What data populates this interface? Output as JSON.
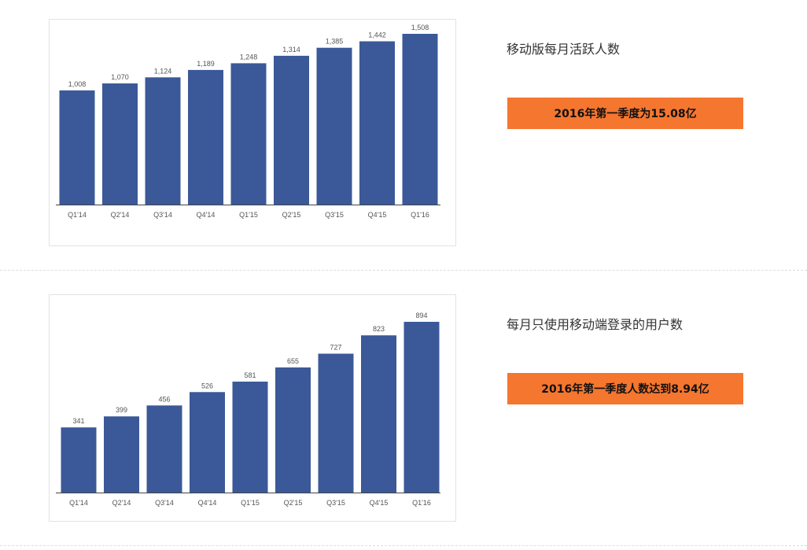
{
  "sections": [
    {
      "side_title": "移动版每月活跃人数",
      "highlight": "2016年第一季度为15.08亿"
    },
    {
      "side_title": "每月只使用移动端登录的用户数",
      "highlight": "2016年第一季度人数达到8.94亿"
    }
  ],
  "colors": {
    "bar": "#3b5998",
    "highlight": "#f5762f"
  },
  "chart_data": [
    {
      "type": "bar",
      "title": "",
      "xlabel": "",
      "ylabel": "",
      "categories": [
        "Q1'14",
        "Q2'14",
        "Q3'14",
        "Q4'14",
        "Q1'15",
        "Q2'15",
        "Q3'15",
        "Q4'15",
        "Q1'16"
      ],
      "values": [
        1008,
        1070,
        1124,
        1189,
        1248,
        1314,
        1385,
        1442,
        1508
      ],
      "value_labels": [
        "1,008",
        "1,070",
        "1,124",
        "1,189",
        "1,248",
        "1,314",
        "1,385",
        "1,442",
        "1,508"
      ],
      "ylim": [
        0,
        1508
      ],
      "grid": false,
      "legend": "none"
    },
    {
      "type": "bar",
      "title": "",
      "xlabel": "",
      "ylabel": "",
      "categories": [
        "Q1'14",
        "Q2'14",
        "Q3'14",
        "Q4'14",
        "Q1'15",
        "Q2'15",
        "Q3'15",
        "Q4'15",
        "Q1'16"
      ],
      "values": [
        341,
        399,
        456,
        526,
        581,
        655,
        727,
        823,
        894
      ],
      "value_labels": [
        "341",
        "399",
        "456",
        "526",
        "581",
        "655",
        "727",
        "823",
        "894"
      ],
      "ylim": [
        0,
        894
      ],
      "grid": false,
      "legend": "none"
    }
  ]
}
